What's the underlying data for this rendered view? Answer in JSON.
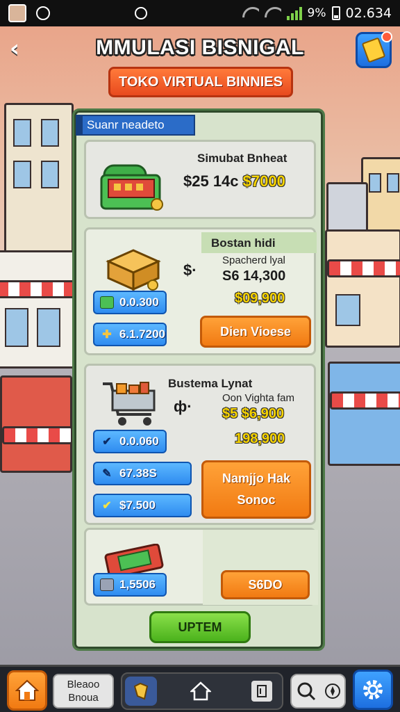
{
  "status_bar": {
    "battery": "9%",
    "time": "02.634"
  },
  "header": {
    "title": "MMULASI BISNIGAL",
    "subtitle_button": "TOKO VIRTUAL  BINNIES"
  },
  "panel": {
    "tab_label": "Suanr neadeto",
    "items": [
      {
        "name": "Simubat Bnheat",
        "price": "$25 14c",
        "price_highlight": "$7000",
        "art": "cash-register-icon"
      },
      {
        "name": "Bostan hidi",
        "price_prefix": "$·",
        "detail_label": "Spacherd lyal",
        "detail_value": "S6 14,300",
        "highlight_value": "$09,900",
        "stats": [
          {
            "icon": "cash-icon",
            "value": "0.0.300"
          },
          {
            "icon": "plus-icon",
            "value": "6.1.7200"
          }
        ],
        "button": "Dien Vioese",
        "art": "crate-icon"
      },
      {
        "name": "Bustema Lynat",
        "price_prefix": "ф·",
        "detail_label": "Oon Vighta fam",
        "detail_value": "$5 $6,900",
        "highlight_value": "198,900",
        "stats": [
          {
            "icon": "check-icon",
            "value": "0.0.060"
          },
          {
            "icon": "tag-icon",
            "value": "67.38S"
          },
          {
            "icon": "check-icon",
            "value": "$7.500"
          }
        ],
        "button_line1": "Namjjo Hak",
        "button_line2": "Sonoc",
        "art": "shopping-cart-icon"
      },
      {
        "stats": [
          {
            "icon": "box-icon",
            "value": "1,5506"
          }
        ],
        "button": "S6DO",
        "art": "card-icon"
      }
    ],
    "confirm_button": "UPTEM"
  },
  "bottom_nav": {
    "label_line1": "Bleaoo",
    "label_line2": "Bnoua",
    "icons": [
      "home-icon",
      "map-icon",
      "house-icon",
      "door-icon",
      "search-icon",
      "compass-icon",
      "gear-icon"
    ]
  },
  "colors": {
    "accent_orange": "#f17a12",
    "accent_blue": "#2f8cf0",
    "accent_green": "#4bb21c",
    "panel_bg": "#d7e3cc"
  }
}
